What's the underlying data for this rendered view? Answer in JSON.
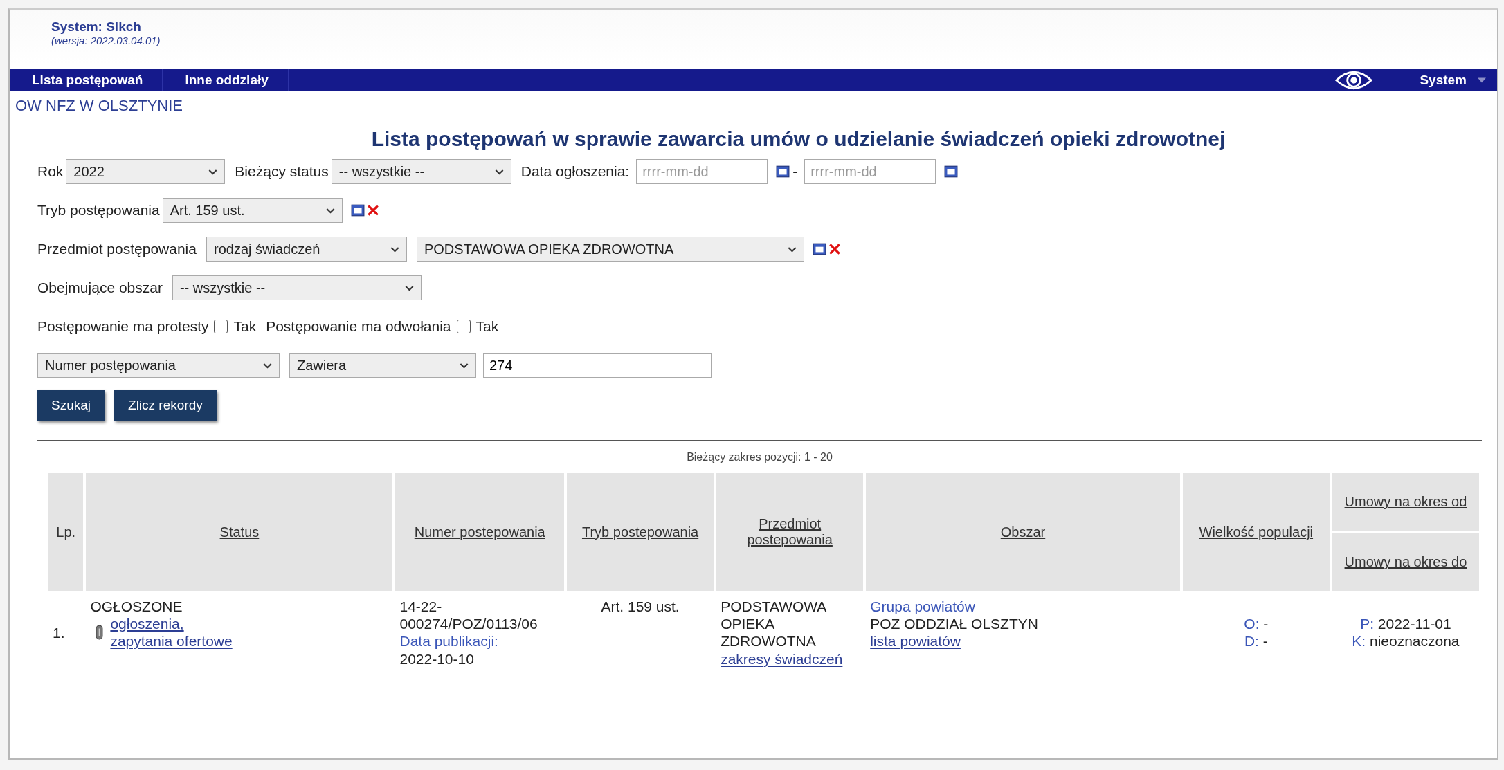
{
  "header": {
    "system_name": "System: Sikch",
    "version": "(wersja: 2022.03.04.01)"
  },
  "nav": {
    "items": [
      {
        "label": "Lista postępowań"
      },
      {
        "label": "Inne oddziały"
      }
    ],
    "menu": "System"
  },
  "organization": "OW NFZ W OLSZTYNIE",
  "title": "Lista postępowań w sprawie zawarcia umów o udzielanie świadczeń opieki zdrowotnej",
  "filters": {
    "year": {
      "label": "Rok",
      "value": "2022"
    },
    "status": {
      "label": "Bieżący status",
      "value": "-- wszystkie --"
    },
    "date": {
      "label": "Data ogłoszenia:",
      "from_placeholder": "rrrr-mm-dd",
      "separator": "-",
      "to_placeholder": "rrrr-mm-dd"
    },
    "mode": {
      "label": "Tryb postępowania",
      "value": "Art. 159 ust."
    },
    "subject": {
      "label": "Przedmiot postępowania",
      "type_value": "rodzaj świadczeń",
      "value": "PODSTAWOWA OPIEKA ZDROWOTNA"
    },
    "area": {
      "label": "Obejmujące obszar",
      "value": "-- wszystkie --"
    },
    "flags": [
      {
        "label": "Postępowanie ma protesty",
        "option": "Tak",
        "checked": false
      },
      {
        "label": "Postępowanie ma odwołania",
        "option": "Tak",
        "checked": false
      }
    ],
    "search": {
      "field": "Numer postępowania",
      "operator": "Zawiera",
      "value": "274"
    }
  },
  "buttons": [
    "Szukaj",
    "Zlicz rekordy"
  ],
  "range": "Bieżący zakres pozycji: 1 - 20",
  "table": {
    "columns": [
      "Lp.",
      "Status",
      "Numer postepowania",
      "Tryb postepowania",
      "Przedmiot postepowania",
      "Obszar",
      "Wielkość populacji"
    ],
    "period_columns": [
      "Umowy na okres od",
      "Umowy na okres do"
    ],
    "rows": [
      {
        "lp": "1.",
        "status": "OGŁOSZONE",
        "status_links": [
          "ogłoszenia,",
          "zapytania ofertowe"
        ],
        "number": "14-22-000274/POZ/0113/06",
        "publication_label": "Data publikacji:",
        "publication_date": "2022-10-10",
        "mode": "Art. 159 ust.",
        "subject": "PODSTAWOWA OPIEKA ZDROWOTNA",
        "subject_link": "zakresy świadczeń",
        "area_group": "Grupa powiatów",
        "area_name": "POZ ODDZIAŁ OLSZTYN",
        "area_link": "lista powiatów",
        "population": {
          "o_prefix": "O:",
          "o_text": "-",
          "d_prefix": "D:",
          "d_text": "-"
        },
        "period": [
          {
            "label": "P:",
            "value": "2022-11-01"
          },
          {
            "label": "K:",
            "value": "nieoznaczona"
          }
        ]
      }
    ]
  }
}
